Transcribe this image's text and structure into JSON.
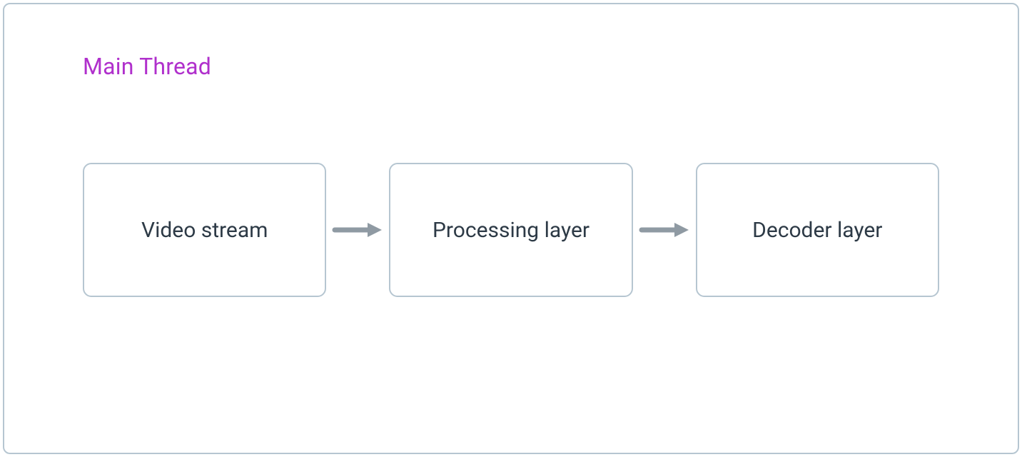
{
  "diagram": {
    "title": "Main Thread",
    "nodes": [
      {
        "id": "video-stream",
        "label": "Video stream"
      },
      {
        "id": "processing-layer",
        "label": "Processing layer"
      },
      {
        "id": "decoder-layer",
        "label": "Decoder layer"
      }
    ],
    "colors": {
      "title": "#b030cc",
      "border": "#b6c6d1",
      "arrow": "#8f9aa3",
      "text": "#2d3a46"
    }
  }
}
